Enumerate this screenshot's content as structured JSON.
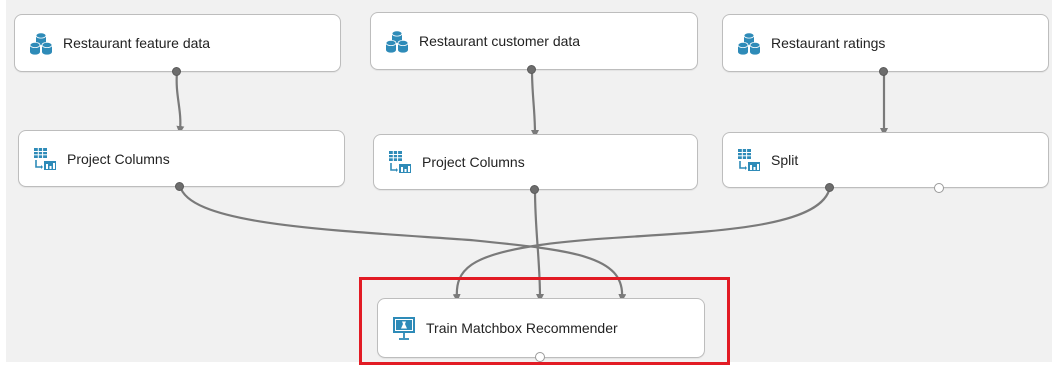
{
  "modules": [
    {
      "id": "m1",
      "label": "Restaurant feature data",
      "icon": "dataset-icon"
    },
    {
      "id": "m2",
      "label": "Restaurant customer data",
      "icon": "dataset-icon"
    },
    {
      "id": "m3",
      "label": "Restaurant ratings",
      "icon": "dataset-icon"
    },
    {
      "id": "m4",
      "label": "Project Columns",
      "icon": "transform-icon"
    },
    {
      "id": "m5",
      "label": "Project Columns",
      "icon": "transform-icon"
    },
    {
      "id": "m6",
      "label": "Split",
      "icon": "transform-icon"
    },
    {
      "id": "m7",
      "label": "Train Matchbox Recommender",
      "icon": "train-icon"
    }
  ],
  "colors": {
    "canvas": "#f1f1f1",
    "connector": "#7a7a7a",
    "highlight": "#e21b24",
    "icon_blue": "#2e8bb8"
  }
}
